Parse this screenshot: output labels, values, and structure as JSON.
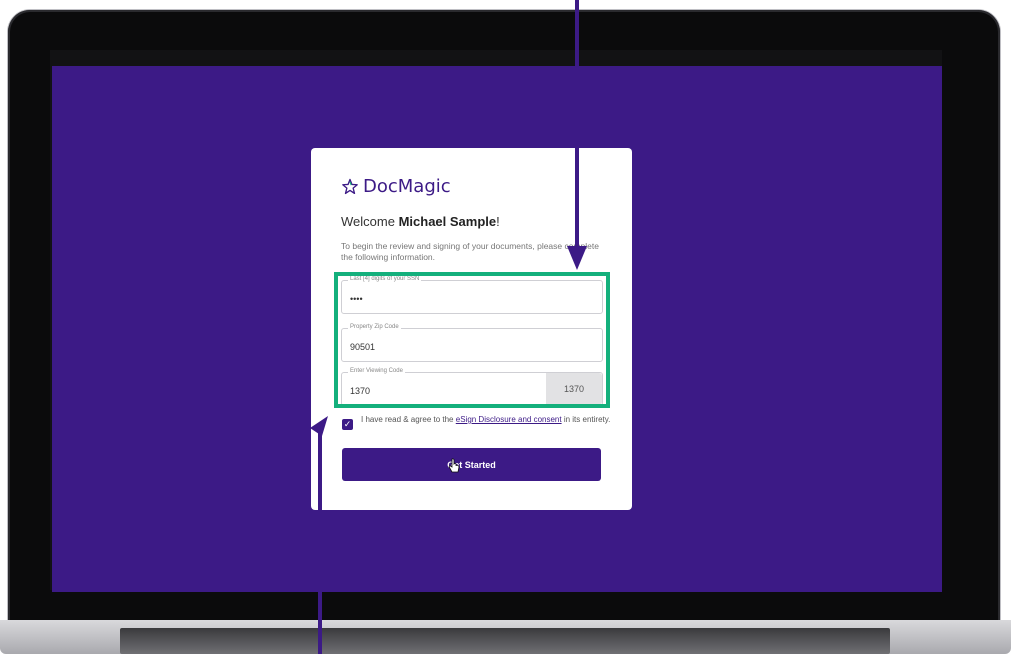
{
  "brand": {
    "name": "DocMagic"
  },
  "welcome": {
    "prefix": "Welcome",
    "name": "Michael Sample",
    "suffix": "!"
  },
  "instructions": "To begin the review and signing of your documents, please complete the following information.",
  "fields": {
    "ssn": {
      "label": "Last [4] digits of your SSN",
      "value": "••••"
    },
    "zip": {
      "label": "Property Zip Code",
      "value": "90501"
    },
    "code": {
      "label": "Enter Viewing Code",
      "value": "1370",
      "display": "1370"
    }
  },
  "consent": {
    "checked": true,
    "text_before": "I have read & agree to the",
    "link": "eSign Disclosure and consent",
    "text_after": "in its entirety."
  },
  "cta": {
    "label": "Get Started"
  },
  "colors": {
    "primary": "#3c1a86",
    "highlight": "#14b07c"
  }
}
